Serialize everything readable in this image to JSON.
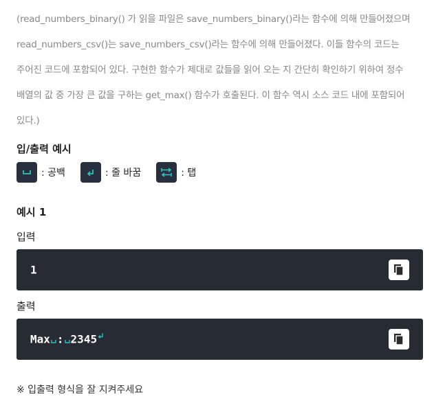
{
  "description": {
    "lines": [
      "(read_numbers_binary() 가 읽을 파일은 save_numbers_binary()라는 함수에 의해 만들어졌으며",
      "read_numbers_csv()는 save_numbers_csv()라는 함수에 의해 만들어졌다. 이들 함수의 코드는",
      "주어진 코드에 포함되어 있다. 구현한 함수가 제대로 값들을 읽어 오는 지 간단히 확인하기 위하여  정수",
      "배열의 값 중 가장 큰 값을 구하는 get_max() 함수가 호출된다. 이 함수 역시 소스 코드 내에 포함되어",
      "있다.)"
    ]
  },
  "io_example": {
    "title": "입/출력 예시",
    "legend": {
      "space_label": ": 공백",
      "newline_label": ": 줄 바꿈",
      "tab_label": ": 탭"
    }
  },
  "example1": {
    "title": "예시 1",
    "input_label": "입력",
    "input_value": "1",
    "output_label": "출력",
    "output_tokens": [
      "Max",
      ":",
      "2345"
    ]
  },
  "footnote": "※ 입출력 형식을 잘 지켜주세요",
  "colors": {
    "code_bg": "#272b33",
    "marker": "#2bc4c0",
    "description_text": "#888888"
  },
  "icons": [
    "space-icon",
    "newline-icon",
    "tab-icon",
    "copy-icon"
  ]
}
